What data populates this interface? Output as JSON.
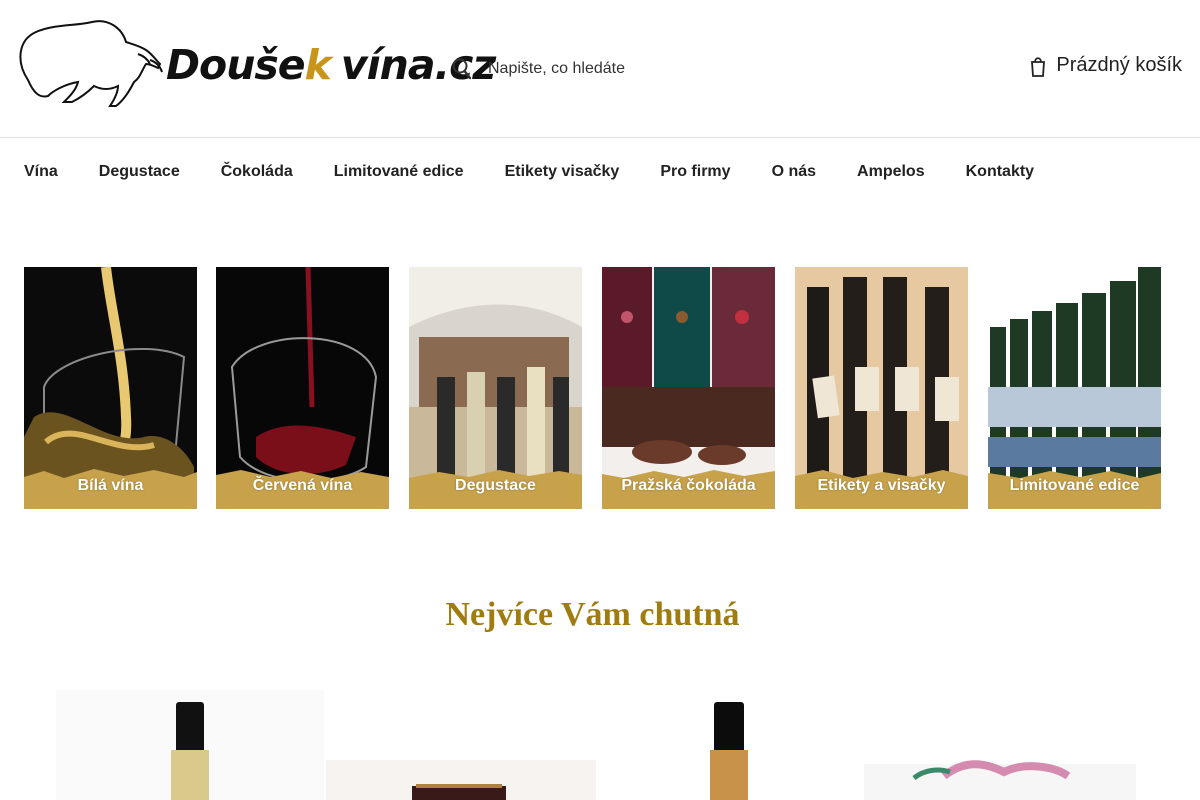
{
  "header": {
    "logo_main": "Doušek",
    "logo_domain": "vína.cz",
    "search_placeholder": "Napište, co hledáte",
    "search_icon": "search-icon",
    "cart_label": "Prázdný košík",
    "cart_icon": "cart-icon"
  },
  "nav": {
    "items": [
      "Vína",
      "Degustace",
      "Čokoláda",
      "Limitované edice",
      "Etikety visačky",
      "Pro firmy",
      "O nás",
      "Ampelos",
      "Kontakty"
    ]
  },
  "categories": [
    {
      "label": "Bílá vína"
    },
    {
      "label": "Červená vína"
    },
    {
      "label": "Degustace"
    },
    {
      "label": "Pražská čokoláda"
    },
    {
      "label": "Etikety a visačky"
    },
    {
      "label": "Limitované edice"
    }
  ],
  "section": {
    "title": "Nejvíce Vám chutná"
  },
  "colors": {
    "accent_gold": "#c8a24a",
    "title_gold": "#a07c10",
    "logo_k": "#c8941a"
  }
}
